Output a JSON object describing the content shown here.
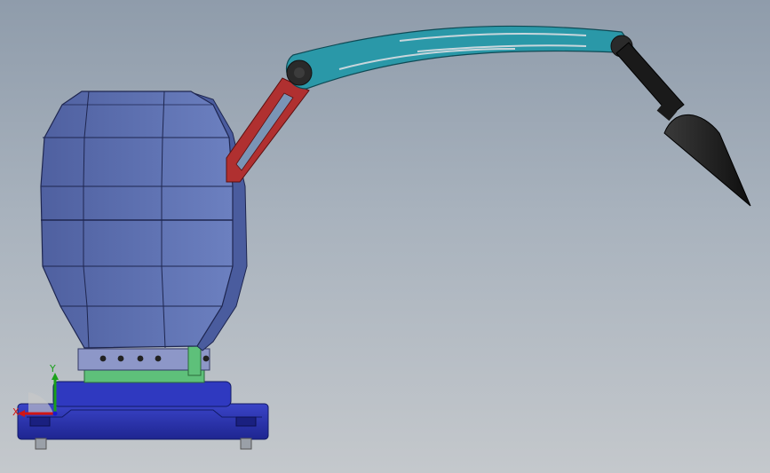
{
  "triad": {
    "x_label": "X",
    "y_label": "Y",
    "x_color": "#d01515",
    "y_color": "#1aa01a",
    "z_color": "#1a1ad0"
  },
  "colors": {
    "background_top": "#8f9cab",
    "background_bottom": "#c4c8cc",
    "housing": "#5b6eae",
    "base": "#2b33b8",
    "flange": "#5ec07a",
    "red_link": "#b03030",
    "teal_link": "#2a98a8",
    "tool_tip": "#1c1c1c"
  }
}
